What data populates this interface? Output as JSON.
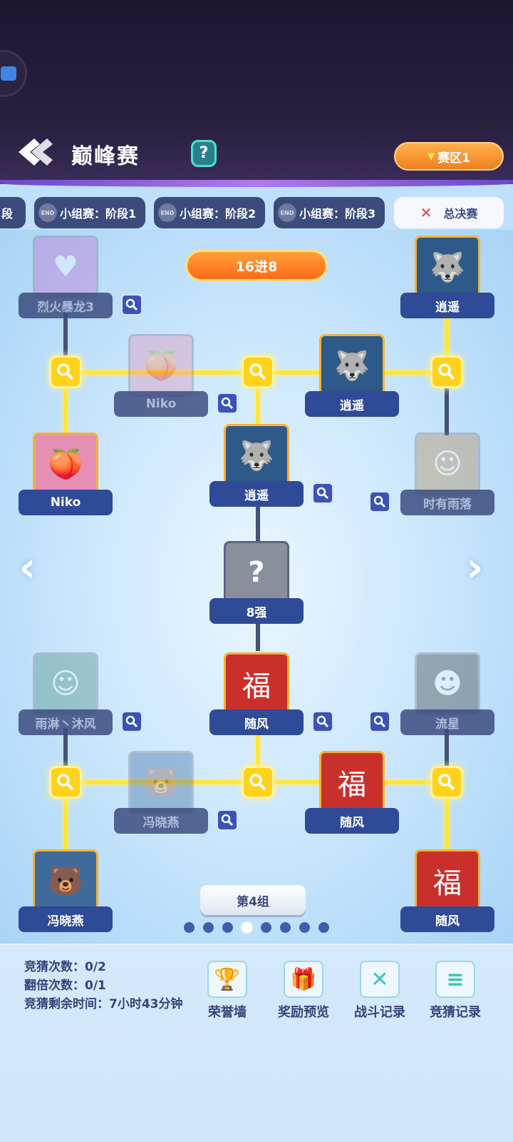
{
  "header": {
    "title": "巅峰赛",
    "help_label": "?",
    "region_label": "赛区1"
  },
  "tabs": [
    {
      "label": "段",
      "end": ""
    },
    {
      "label": "小组赛：阶段1",
      "end": "END"
    },
    {
      "label": "小组赛：阶段2",
      "end": "END"
    },
    {
      "label": "小组赛：阶段3",
      "end": "END"
    },
    {
      "label": "总决赛",
      "end": ""
    }
  ],
  "bracket": {
    "round_label": "16进8",
    "center_label": "8强",
    "center_mark": "?",
    "top": {
      "left_seed_1": "烈火暴龙3",
      "left_seed_2": "Niko",
      "left_winner": "Niko",
      "right_seed_1": "逍遥",
      "right_seed_2": "时有雨落",
      "right_winner": "逍遥",
      "semi_winner": "逍遥"
    },
    "bottom": {
      "left_seed_1": "雨淋丶沐风",
      "left_seed_2": "冯晓燕",
      "left_winner": "冯晓燕",
      "right_seed_1": "流星",
      "right_seed_2": "随风",
      "right_winner": "随风",
      "semi_winner": "随风"
    },
    "group_label": "第4组",
    "page_count": 8,
    "active_page": 4
  },
  "stats": {
    "guess_count": "竞猜次数：0/2",
    "double_count": "翻倍次数：0/1",
    "remaining_time": "竞猜剩余时间：7小时43分钟"
  },
  "actions": [
    {
      "label": "荣誉墙",
      "icon": "trophy-icon"
    },
    {
      "label": "奖励预览",
      "icon": "gift-icon"
    },
    {
      "label": "战斗记录",
      "icon": "crossed-swords-icon"
    },
    {
      "label": "竞猜记录",
      "icon": "document-icon"
    }
  ],
  "colors": {
    "accent_orange": "#ff7a1f",
    "gold_line": "#ffe53a",
    "nameplate_blue": "#2f4a97"
  }
}
